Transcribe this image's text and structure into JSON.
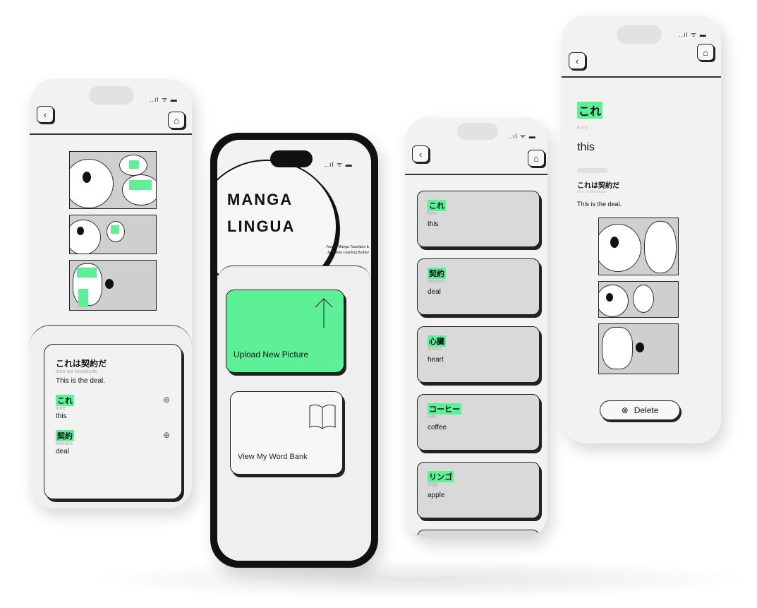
{
  "status_icons": "..ıl ᯤ ▬",
  "phone1": {
    "sentence_jp": "これは契約だ",
    "sentence_romaji": "kore wa keiyakuda",
    "sentence_en": "This is the deal.",
    "words": [
      {
        "jp": "これ",
        "romaji": "kore",
        "en": "this"
      },
      {
        "jp": "契約",
        "romaji": "keiyaku",
        "en": "deal"
      }
    ]
  },
  "phone2": {
    "brand_line1": "MANGA",
    "brand_line2": "LINGUA",
    "tagline": "Your AI Manga Translator & Japanese Learning Buddy!",
    "upload_label": "Upload New Picture",
    "wordbank_label": "View My Word Bank"
  },
  "phone3": {
    "words": [
      {
        "jp": "これ",
        "romaji": "kore",
        "en": "this"
      },
      {
        "jp": "契約",
        "romaji": "keiyaku",
        "en": "deal"
      },
      {
        "jp": "心臓",
        "romaji": "shinzo",
        "en": "heart"
      },
      {
        "jp": "コーヒー",
        "romaji": "kohi",
        "en": "coffee"
      },
      {
        "jp": "リンゴ",
        "romaji": "ringo",
        "en": "apple"
      }
    ]
  },
  "phone4": {
    "word_jp": "これ",
    "word_romaji": "kore",
    "word_en": "this",
    "sentence_jp": "これは契約だ",
    "sentence_romaji": "kore wa keiyakuda",
    "sentence_en": "This is the deal.",
    "delete_label": "Delete"
  },
  "colors": {
    "accent": "#5ef097",
    "ink": "#111111",
    "surface": "#f2f2f2"
  }
}
